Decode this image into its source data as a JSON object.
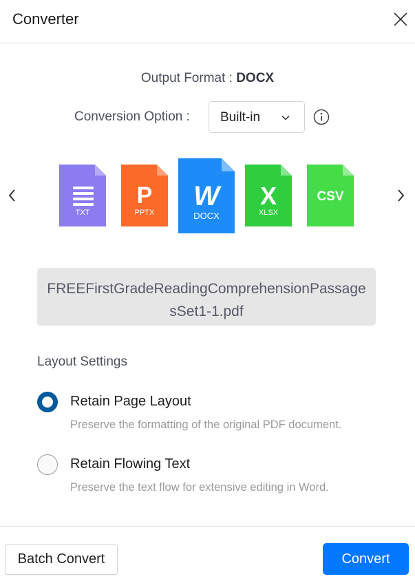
{
  "dialog": {
    "title": "Converter",
    "close_icon": "close-icon"
  },
  "output": {
    "label": "Output Format :",
    "format": "DOCX"
  },
  "conversion": {
    "label": "Conversion Option :",
    "selected": "Built-in",
    "info_icon": "info-icon"
  },
  "formats": [
    {
      "name": "TXT",
      "glyph": "",
      "color": "#8b7cf0",
      "selected": false
    },
    {
      "name": "PPTX",
      "glyph": "P",
      "color": "#fb6a28",
      "selected": false
    },
    {
      "name": "DOCX",
      "glyph": "W",
      "color": "#1e8cf8",
      "selected": true
    },
    {
      "name": "XLSX",
      "glyph": "X",
      "color": "#2fce3f",
      "selected": false
    },
    {
      "name": "CSV",
      "glyph": "",
      "color": "#45dc48",
      "selected": false
    }
  ],
  "file": {
    "name": "FREEFirstGradeReadingComprehensionPassagesSet1-1.pdf"
  },
  "layout_settings": {
    "title": "Layout Settings",
    "options": [
      {
        "label": "Retain Page Layout",
        "description": "Preserve the formatting of the original PDF document.",
        "selected": true
      },
      {
        "label": "Retain Flowing Text",
        "description": "Preserve the text flow for extensive editing in Word.",
        "selected": false
      }
    ]
  },
  "footer": {
    "batch_label": "Batch Convert",
    "convert_label": "Convert"
  },
  "colors": {
    "accent": "#0078ff",
    "radio_selected": "#005a9e"
  }
}
